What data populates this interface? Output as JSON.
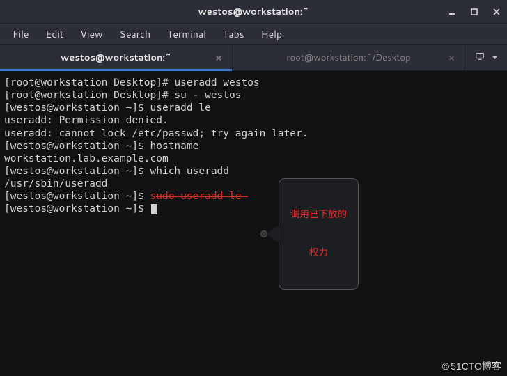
{
  "window": {
    "title": "westos@workstation:~"
  },
  "menubar": [
    "File",
    "Edit",
    "View",
    "Search",
    "Terminal",
    "Tabs",
    "Help"
  ],
  "tabs": [
    {
      "label": "westos@workstation:~",
      "active": true
    },
    {
      "label": "root@workstation:~/Desktop",
      "active": false
    }
  ],
  "terminal_lines": [
    {
      "prompt": "[root@workstation Desktop]# ",
      "cmd": "useradd westos"
    },
    {
      "prompt": "[root@workstation Desktop]# ",
      "cmd": "su - westos"
    },
    {
      "prompt": "[westos@workstation ~]$ ",
      "cmd": "useradd le"
    },
    {
      "out": "useradd: Permission denied."
    },
    {
      "out": "useradd: cannot lock /etc/passwd; try again later."
    },
    {
      "prompt": "[westos@workstation ~]$ ",
      "cmd": "hostname"
    },
    {
      "out": "workstation.lab.example.com"
    },
    {
      "prompt": "[westos@workstation ~]$ ",
      "cmd": "which useradd"
    },
    {
      "out": "/usr/sbin/useradd"
    },
    {
      "prompt": "[westos@workstation ~]$ ",
      "cmd": "sudo useradd le",
      "cmd_red": true
    },
    {
      "prompt": "[westos@workstation ~]$ ",
      "cmd": "",
      "cursor": true
    }
  ],
  "annotation": {
    "line1": "调用已下放的",
    "line2": "权力"
  },
  "watermark": "51CTO博客"
}
